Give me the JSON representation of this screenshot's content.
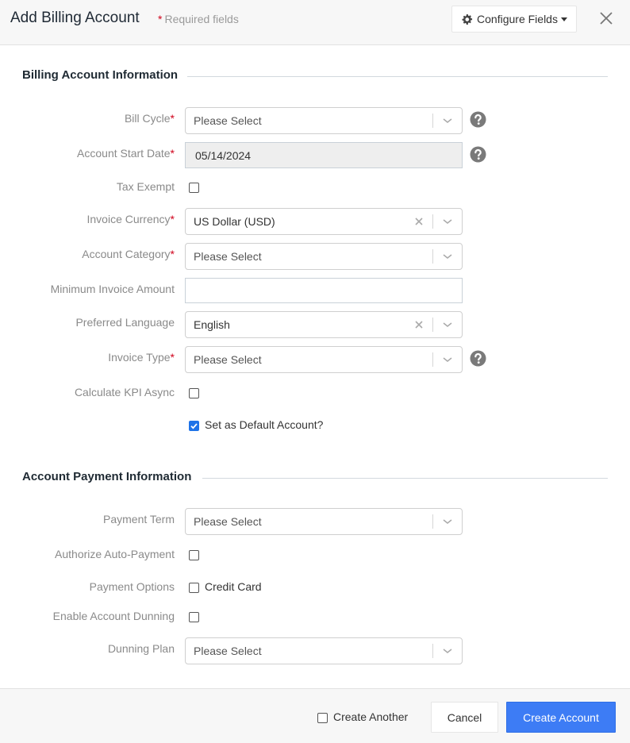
{
  "header": {
    "title": "Add Billing Account",
    "required_star": "*",
    "required_note": "Required fields",
    "configure_label": "Configure Fields",
    "configure_icon": "gear-icon",
    "close_icon": "close-icon"
  },
  "sections": {
    "billing": "Billing Account Information",
    "payment": "Account Payment Information"
  },
  "fields": {
    "bill_cycle": {
      "label": "Bill Cycle",
      "required": "*",
      "value": "Please Select"
    },
    "start_date": {
      "label": "Account Start Date",
      "required": "*",
      "value": "05/14/2024"
    },
    "tax_exempt": {
      "label": "Tax Exempt",
      "checked": false
    },
    "invoice_currency": {
      "label": "Invoice Currency",
      "required": "*",
      "value": "US Dollar (USD)"
    },
    "account_category": {
      "label": "Account Category",
      "required": "*",
      "value": "Please Select"
    },
    "min_invoice": {
      "label": "Minimum Invoice Amount",
      "value": ""
    },
    "preferred_language": {
      "label": "Preferred Language",
      "value": "English"
    },
    "invoice_type": {
      "label": "Invoice Type",
      "required": "*",
      "value": "Please Select"
    },
    "kpi_async": {
      "label": "Calculate KPI Async",
      "checked": false
    },
    "default_account": {
      "label": "Set as Default Account?",
      "checked": true
    },
    "payment_term": {
      "label": "Payment Term",
      "value": "Please Select"
    },
    "auto_payment": {
      "label": "Authorize Auto-Payment",
      "checked": false
    },
    "payment_options": {
      "label": "Payment Options",
      "option": "Credit Card",
      "checked": false
    },
    "dunning": {
      "label": "Enable Account Dunning",
      "checked": false
    },
    "dunning_plan": {
      "label": "Dunning Plan",
      "value": "Please Select"
    }
  },
  "footer": {
    "create_another": "Create Another",
    "create_another_checked": false,
    "cancel": "Cancel",
    "create": "Create Account"
  },
  "colors": {
    "primary": "#3d7cf5",
    "required": "#d0021b",
    "checkbox_checked": "#1f73e8"
  }
}
